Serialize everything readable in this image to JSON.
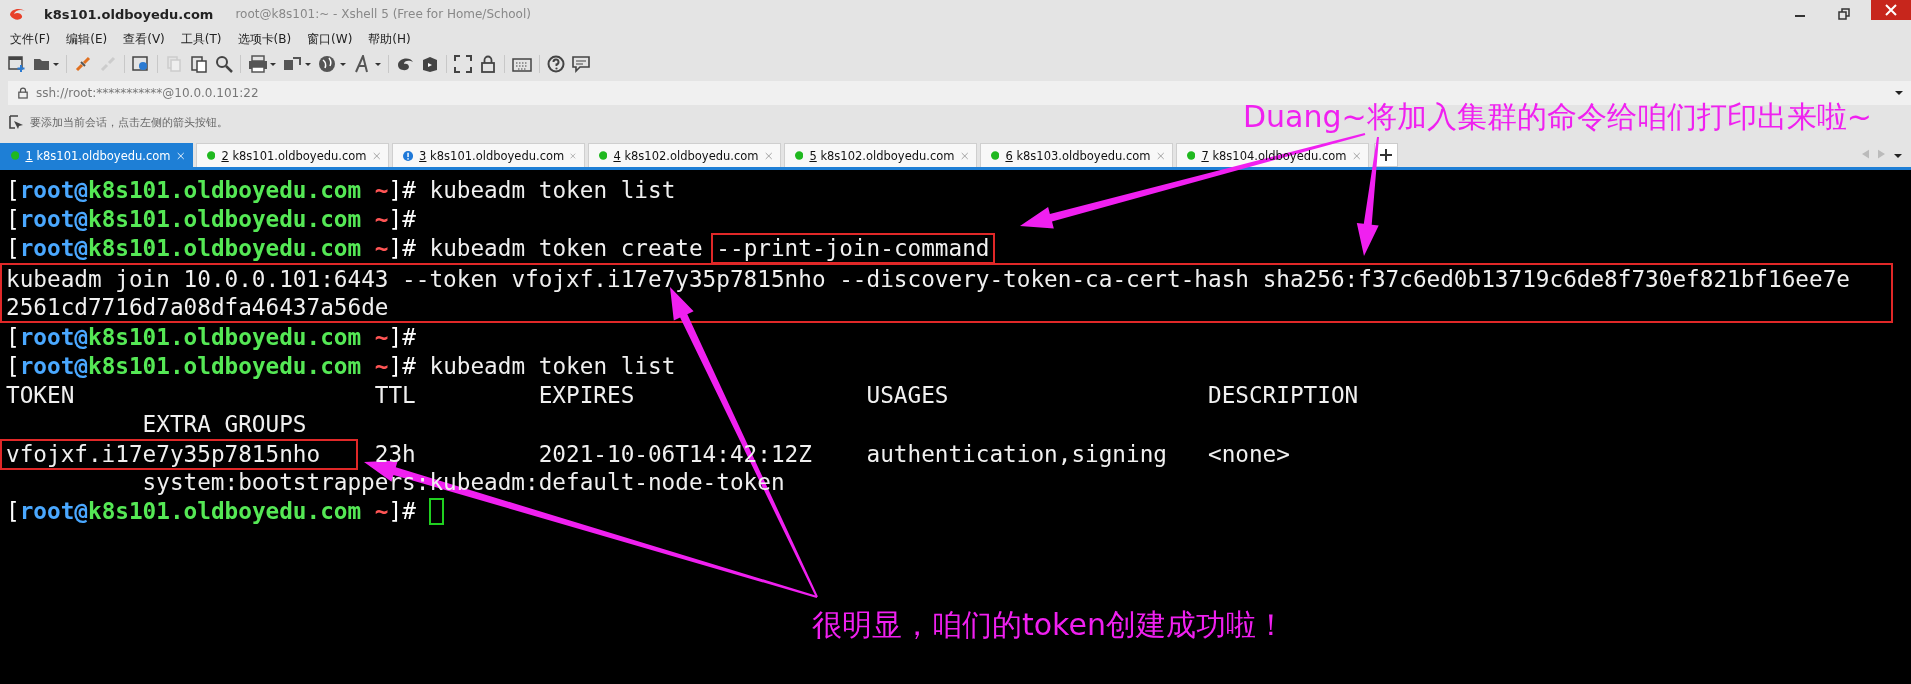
{
  "window": {
    "title": "k8s101.oldboyedu.com",
    "subtitle": "root@k8s101:~ - Xshell 5 (Free for Home/School)"
  },
  "menu": [
    "文件(F)",
    "编辑(E)",
    "查看(V)",
    "工具(T)",
    "选项卡(B)",
    "窗口(W)",
    "帮助(H)"
  ],
  "address_bar": {
    "value": "ssh://root:***********@10.0.0.101:22"
  },
  "hint_bar": {
    "text": "要添加当前会话，点击左侧的箭头按钮。"
  },
  "tabs": [
    {
      "number": "1",
      "label": "k8s101.oldboyedu.com",
      "kind": "connected",
      "selected": true
    },
    {
      "number": "2",
      "label": "k8s101.oldboyedu.com",
      "kind": "connected",
      "selected": false
    },
    {
      "number": "3",
      "label": "k8s101.oldboyedu.com",
      "kind": "alert",
      "selected": false
    },
    {
      "number": "4",
      "label": "k8s102.oldboyedu.com",
      "kind": "connected",
      "selected": false
    },
    {
      "number": "5",
      "label": "k8s102.oldboyedu.com",
      "kind": "connected",
      "selected": false
    },
    {
      "number": "6",
      "label": "k8s103.oldboyedu.com",
      "kind": "connected",
      "selected": false
    },
    {
      "number": "7",
      "label": "k8s104.oldboyedu.com",
      "kind": "connected",
      "selected": false
    }
  ],
  "terminal": {
    "lines": [
      {
        "kind": "prompt",
        "prompt": [
          {
            "text": "[",
            "color": "#ffffff"
          },
          {
            "text": "root@",
            "color": "#4aa8ff"
          },
          {
            "text": "k8s101.oldboyedu.com",
            "color": "#55e855"
          },
          {
            "text": " ~",
            "color": "#ff5555"
          },
          {
            "text": "]#",
            "color": "#ffffff"
          }
        ],
        "command": "kubeadm token list"
      },
      {
        "kind": "prompt",
        "prompt": [
          {
            "text": "[",
            "color": "#ffffff"
          },
          {
            "text": "root@",
            "color": "#4aa8ff"
          },
          {
            "text": "k8s101.oldboyedu.com",
            "color": "#55e855"
          },
          {
            "text": " ~",
            "color": "#ff5555"
          },
          {
            "text": "]#",
            "color": "#ffffff"
          }
        ]
      },
      {
        "kind": "prompt",
        "prompt": [
          {
            "text": "[",
            "color": "#ffffff"
          },
          {
            "text": "root@",
            "color": "#4aa8ff"
          },
          {
            "text": "k8s101.oldboyedu.com",
            "color": "#55e855"
          },
          {
            "text": " ~",
            "color": "#ff5555"
          },
          {
            "text": "]#",
            "color": "#ffffff"
          }
        ],
        "command": "kubeadm token create",
        "highlighted_arg": "--print-join-command"
      },
      {
        "kind": "boxed_output",
        "lines": [
          "kubeadm join 10.0.0.101:6443 --token vfojxf.i17e7y35p7815nho --discovery-token-ca-cert-hash sha256:f37c6ed0b13719c6de8f730ef821bf16ee7e",
          "2561cd7716d7a08dfa46437a56de"
        ]
      },
      {
        "kind": "prompt",
        "prompt": [
          {
            "text": "[",
            "color": "#ffffff"
          },
          {
            "text": "root@",
            "color": "#4aa8ff"
          },
          {
            "text": "k8s101.oldboyedu.com",
            "color": "#55e855"
          },
          {
            "text": " ~",
            "color": "#ff5555"
          },
          {
            "text": "]#",
            "color": "#ffffff"
          }
        ]
      },
      {
        "kind": "prompt",
        "prompt": [
          {
            "text": "[",
            "color": "#ffffff"
          },
          {
            "text": "root@",
            "color": "#4aa8ff"
          },
          {
            "text": "k8s101.oldboyedu.com",
            "color": "#55e855"
          },
          {
            "text": " ~",
            "color": "#ff5555"
          },
          {
            "text": "]#",
            "color": "#ffffff"
          }
        ],
        "command": "kubeadm token list"
      },
      {
        "kind": "table_row",
        "cells": [
          {
            "text": "TOKEN",
            "highlighted": false
          },
          {
            "text": "TTL",
            "highlighted": false
          },
          {
            "text": "EXPIRES",
            "highlighted": false
          },
          {
            "text": "USAGES",
            "highlighted": false
          },
          {
            "text": "DESCRIPTION",
            "highlighted": false
          }
        ],
        "extra": "EXTRA GROUPS"
      },
      {
        "kind": "table_row",
        "cells": [
          {
            "text": "vfojxf.i17e7y35p7815nho",
            "highlighted": true
          },
          {
            "text": "23h",
            "highlighted": false
          },
          {
            "text": "2021-10-06T14:42:12Z",
            "highlighted": false
          },
          {
            "text": "authentication,signing",
            "highlighted": false
          },
          {
            "text": "<none>",
            "highlighted": false
          }
        ],
        "extra": "system:bootstrappers:kubeadm:default-node-token"
      },
      {
        "kind": "prompt",
        "prompt": [
          {
            "text": "[",
            "color": "#ffffff"
          },
          {
            "text": "root@",
            "color": "#4aa8ff"
          },
          {
            "text": "k8s101.oldboyedu.com",
            "color": "#55e855"
          },
          {
            "text": " ~",
            "color": "#ff5555"
          },
          {
            "text": "]#",
            "color": "#ffffff"
          }
        ],
        "cursor": true
      }
    ]
  },
  "annotations": [
    {
      "kind": "top",
      "text": "Duang~将加入集群的命令给咱们打印出来啦~"
    },
    {
      "kind": "bottom",
      "text": "很明显，咱们的token创建成功啦！"
    }
  ]
}
